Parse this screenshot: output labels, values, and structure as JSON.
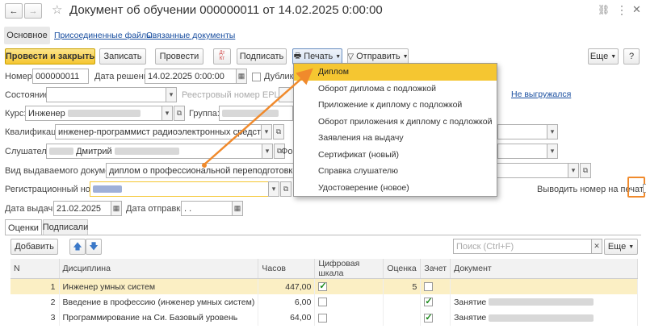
{
  "window": {
    "title": "Документ об обучении 000000011 от 14.02.2025 0:00:00",
    "nav_back": "←",
    "nav_fwd": "→",
    "star": "☆",
    "more": "⋮",
    "close": "✕",
    "link_icon": "🔗"
  },
  "tabs": [
    {
      "label": "Основное"
    },
    {
      "label": "Присоединенные файлы"
    },
    {
      "label": "Связанные документы"
    }
  ],
  "toolbar": {
    "post_close": "Провести и закрыть",
    "save": "Записать",
    "post": "Провести",
    "dt_kt_top": "Дт",
    "dt_kt_bottom": "Кт",
    "sign": "Подписать",
    "print": "Печать",
    "send": "Отправить",
    "more": "Еще"
  },
  "print_menu": [
    "Диплом",
    "Оборот диплома с подложкой",
    "Приложение к диплому с подложкой",
    "Оборот приложения к диплому с подложкой",
    "Заявления на выдачу",
    "Сертификат (новый)",
    "Справка слушателю",
    "Удостоверение (новое)"
  ],
  "form": {
    "number_label": "Номер:",
    "number": "000000011",
    "decision_label": "Дата решения:",
    "decision": "14.02.2025  0:00:00",
    "duplicate_label": "Дубликат",
    "state_label": "Состояние:",
    "registry_label": "Реестровый номер ЕРЦДО:",
    "unloaded": "Не выгружался",
    "course_label": "Курс:",
    "course": "Инженер",
    "group_label": "Группа:",
    "qual_label": "Квалификация:",
    "qual": "инженер-программист радиоэлектронных средств и компле",
    "listener_label": "Слушатель:",
    "listener": "Дмитрий",
    "form_label": "Фор",
    "doctype_label": "Вид выдаваемого документа:",
    "doctype": "диплом о профессиональной переподготовке",
    "regnum_label": "Регистрационный номер:",
    "print_num_label": "Выводить номер на печать:",
    "issue_label": "Дата выдачи:",
    "issue": "21.02.2025",
    "send_label": "Дата отправки:",
    "send": " .  ."
  },
  "subtabs": [
    {
      "label": "Оценки"
    },
    {
      "label": "Подписали"
    }
  ],
  "grid_toolbar": {
    "add": "Добавить",
    "search_placeholder": "Поиск (Ctrl+F)",
    "more": "Еще"
  },
  "grid": {
    "headers": [
      "N",
      "Дисциплина",
      "Часов",
      "Цифровая шкала",
      "Оценка",
      "Зачет",
      "Документ"
    ],
    "rows": [
      {
        "n": "1",
        "disc": "Инженер умных систем",
        "hours": "447,00",
        "digital": true,
        "grade": "5",
        "pass": false,
        "doc": ""
      },
      {
        "n": "2",
        "disc": "Введение в профессию (инженер умных систем)",
        "hours": "6,00",
        "digital": false,
        "grade": "",
        "pass": true,
        "doc": "Занятие"
      },
      {
        "n": "3",
        "disc": "Программирование на Си. Базовый уровень",
        "hours": "64,00",
        "digital": false,
        "grade": "",
        "pass": true,
        "doc": "Занятие"
      }
    ]
  },
  "colors": {
    "accent": "#f5c631",
    "arrow": "#f08a2c",
    "link": "#1a4fa0"
  }
}
